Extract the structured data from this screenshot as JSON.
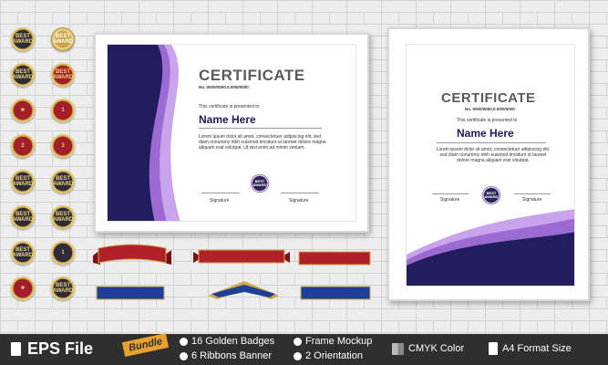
{
  "badges": [
    {
      "label": "BEST\nAWARD",
      "style": "dark"
    },
    {
      "label": "BEST\nAWARD",
      "style": "gold"
    },
    {
      "label": "BEST\nAWARD",
      "style": "dark"
    },
    {
      "label": "BEST\nAWARD",
      "style": "red"
    },
    {
      "label": "★",
      "style": "red"
    },
    {
      "label": "1",
      "style": "red"
    },
    {
      "label": "2",
      "style": "red"
    },
    {
      "label": "3",
      "style": "red"
    },
    {
      "label": "BEST\nAWARD",
      "style": "dark"
    },
    {
      "label": "BEST\nAWARD",
      "style": "dark"
    },
    {
      "label": "BEST\nAWARD",
      "style": "dark"
    },
    {
      "label": "BEST\nAWARD",
      "style": "dark"
    },
    {
      "label": "BEST\nAWARD",
      "style": "dark"
    },
    {
      "label": "1",
      "style": "dark"
    },
    {
      "label": "★",
      "style": "red"
    },
    {
      "label": "BEST\nAWARD",
      "style": "dark"
    }
  ],
  "landscape": {
    "title": "CERTIFICATE",
    "number": "No. 0000/0000.0.0/00/0000",
    "presented": "This certificate is presented to",
    "name": "Name Here",
    "body": "Lorem ipsum dolor sit amet, consectetuer adipiscing elit, sed diam nonummy nibh euismod tincidunt ut laoreet dolore magna aliquam erat volutpat. Ut wisi enim ad minim veniam.",
    "seal": "BEST\nAWARD",
    "sig1": "Signature",
    "sig2": "Signature"
  },
  "portrait": {
    "title": "CERTIFICATE",
    "number": "No. 0000/0000.0.0/00/0000",
    "presented": "This certificate is presented to",
    "name": "Name Here",
    "body": "Lorem ipsum dolor sit amet, consectetuer adipiscing elit, sed diam nonummy nibh euismod tincidunt ut laoreet dolore magna aliquam erat volutpat.",
    "seal": "BEST\nAWARD",
    "sig1": "Signature",
    "sig2": "Signature"
  },
  "footer": {
    "eps": "EPS File",
    "bundle": "Bundle",
    "f1": "16 Golden Badges",
    "f2": "6  Ribbons Banner",
    "f3": "Frame Mockup",
    "f4": "2 Orientation",
    "f5": "CMYK Color",
    "f6": "A4 Format Size"
  },
  "colors": {
    "navy": "#221d5c",
    "purple": "#9b6bd3",
    "lilac": "#c9a4ea",
    "red": "#b0202a",
    "blue": "#1f3f96",
    "gold": "#d2aa45"
  }
}
